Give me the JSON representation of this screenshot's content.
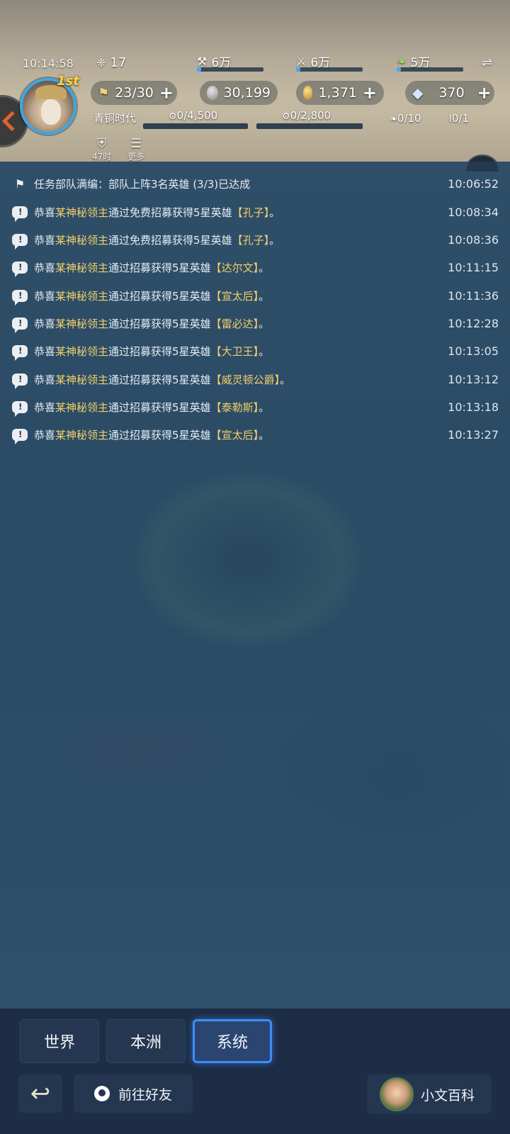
{
  "hud": {
    "clock": "10:14:58",
    "energy": "17",
    "resources_top": [
      {
        "name": "wood-icon",
        "value": "6万",
        "fill": 0.06
      },
      {
        "name": "iron-icon",
        "value": "6万",
        "fill": 0.06
      },
      {
        "name": "grain-icon",
        "value": "5万",
        "fill": 0.06
      }
    ],
    "swap_glyph": "⇌",
    "troops": "23/30",
    "silver": "30,199",
    "gold": "1,371",
    "diamonds": "370",
    "plus": "+",
    "age": "青铜时代",
    "age_progress_1": "0/4,500",
    "age_progress_2": "0/2,800",
    "count_1": "0/10",
    "count_2": "0/1",
    "rank": "1st",
    "btn_timer": "47时",
    "btn_more": "更多"
  },
  "messages": [
    {
      "type": "task",
      "text": "任务部队满编：部队上阵3名英雄 (3/3)已达成",
      "time": "10:06:52"
    },
    {
      "type": "recruit",
      "prefix": "恭喜",
      "lord": "某神秘领主",
      "mid": "通过免费招募获得5星英雄",
      "hero": "【孔子】",
      "suffix": "。",
      "time": "10:08:34"
    },
    {
      "type": "recruit",
      "prefix": "恭喜",
      "lord": "某神秘领主",
      "mid": "通过免费招募获得5星英雄",
      "hero": "【孔子】",
      "suffix": "。",
      "time": "10:08:36"
    },
    {
      "type": "recruit",
      "prefix": "恭喜",
      "lord": "某神秘领主",
      "mid": "通过招募获得5星英雄",
      "hero": "【达尔文】",
      "suffix": "。",
      "time": "10:11:15"
    },
    {
      "type": "recruit",
      "prefix": "恭喜",
      "lord": "某神秘领主",
      "mid": "通过招募获得5星英雄",
      "hero": "【宣太后】",
      "suffix": "。",
      "time": "10:11:36"
    },
    {
      "type": "recruit",
      "prefix": "恭喜",
      "lord": "某神秘领主",
      "mid": "通过招募获得5星英雄",
      "hero": "【雷必达】",
      "suffix": "。",
      "time": "10:12:28"
    },
    {
      "type": "recruit",
      "prefix": "恭喜",
      "lord": "某神秘领主",
      "mid": "通过招募获得5星英雄",
      "hero": "【大卫王】",
      "suffix": "。",
      "time": "10:13:05"
    },
    {
      "type": "recruit",
      "prefix": "恭喜",
      "lord": "某神秘领主",
      "mid": "通过招募获得5星英雄",
      "hero": "【威灵顿公爵】",
      "suffix": "。",
      "time": "10:13:12"
    },
    {
      "type": "recruit",
      "prefix": "恭喜",
      "lord": "某神秘领主",
      "mid": "通过招募获得5星英雄",
      "hero": "【泰勒斯】",
      "suffix": "。",
      "time": "10:13:18"
    },
    {
      "type": "recruit",
      "prefix": "恭喜",
      "lord": "某神秘领主",
      "mid": "通过招募获得5星英雄",
      "hero": "【宣太后】",
      "suffix": "。",
      "time": "10:13:27"
    }
  ],
  "tabs": [
    {
      "label": "世界",
      "active": false
    },
    {
      "label": "本洲",
      "active": false
    },
    {
      "label": "系统",
      "active": true
    }
  ],
  "footer": {
    "back_glyph": "↩",
    "friend_label": "前往好友",
    "wiki_label": "小文百科"
  },
  "colors": {
    "accent": "#3d8dff",
    "highlight_gold": "#f3cf6a",
    "panel_dark": "#1d2d45"
  }
}
